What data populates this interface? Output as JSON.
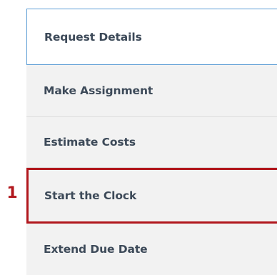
{
  "nav": {
    "items": [
      {
        "label": "Request Details",
        "state": "active"
      },
      {
        "label": "Make Assignment",
        "state": "default"
      },
      {
        "label": "Estimate Costs",
        "state": "default"
      },
      {
        "label": "Start the Clock",
        "state": "highlighted"
      },
      {
        "label": "Extend Due Date",
        "state": "default"
      }
    ]
  },
  "callout": {
    "number": "1"
  },
  "colors": {
    "active_border": "#5f9fd6",
    "highlight_border": "#b1171d",
    "item_background": "#f2f2f2",
    "label_text": "#3d4a59"
  }
}
